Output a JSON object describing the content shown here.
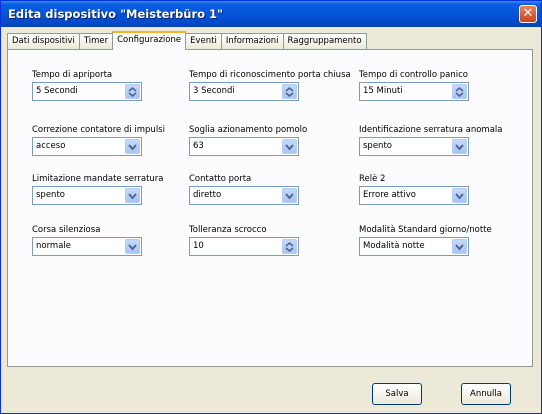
{
  "window": {
    "title": "Edita dispositivo \"Meisterbüro 1\"",
    "close_label": "✕"
  },
  "tabs": [
    {
      "label": "Dati dispositivi",
      "active": false
    },
    {
      "label": "Timer",
      "active": false
    },
    {
      "label": "Configurazione",
      "active": true
    },
    {
      "label": "Eventi",
      "active": false
    },
    {
      "label": "Informazioni",
      "active": false
    },
    {
      "label": "Raggruppamento",
      "active": false
    }
  ],
  "fields": [
    {
      "label": "Tempo di apriporta",
      "value": "5 Secondi",
      "control": "spinner"
    },
    {
      "label": "Tempo di riconoscimento porta chiusa",
      "value": "3 Secondi",
      "control": "spinner"
    },
    {
      "label": "Tempo di controllo panico",
      "value": "15 Minuti",
      "control": "spinner"
    },
    {
      "label": "Correzione contatore di impulsi",
      "value": "acceso",
      "control": "dropdown"
    },
    {
      "label": "Soglia azionamento pomolo",
      "value": "63",
      "control": "dropdown"
    },
    {
      "label": "Identificazione serratura anomala",
      "value": "spento",
      "control": "dropdown"
    },
    {
      "label": "Limitazione mandate serratura",
      "value": "spento",
      "control": "dropdown"
    },
    {
      "label": "Contatto porta",
      "value": "diretto",
      "control": "dropdown"
    },
    {
      "label": "Relè 2",
      "value": "Errore attivo",
      "control": "dropdown"
    },
    {
      "label": "Corsa silenziosa",
      "value": "normale",
      "control": "dropdown"
    },
    {
      "label": "Tolleranza scrocco",
      "value": "10",
      "control": "spinner"
    },
    {
      "label": "Modalità Standard giorno/notte",
      "value": "Modalità notte",
      "control": "dropdown"
    }
  ],
  "buttons": {
    "save": "Salva",
    "cancel": "Annulla"
  },
  "colors": {
    "titlebar": "#0454d8",
    "accent_tab": "#f6b32a",
    "close": "#c9431d"
  }
}
